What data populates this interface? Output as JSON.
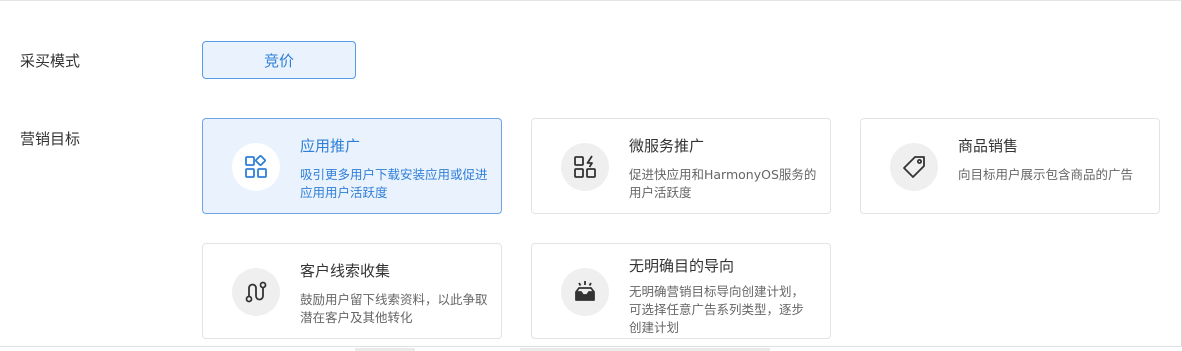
{
  "form": {
    "purchase_mode": {
      "label": "采买模式",
      "options": [
        "竞价"
      ],
      "selected": "竞价"
    },
    "marketing_goal": {
      "label": "营销目标",
      "cards": [
        {
          "title": "应用推广",
          "description": "吸引更多用户下载安装应用或促进应用用户活跃度",
          "icon": "app-grid-icon",
          "selected": true
        },
        {
          "title": "微服务推广",
          "description": "促进快应用和HarmonyOS服务的用户活跃度",
          "icon": "service-grid-icon",
          "selected": false
        },
        {
          "title": "商品销售",
          "description": "向目标用户展示包含商品的广告",
          "icon": "price-tag-icon",
          "selected": false
        },
        {
          "title": "客户线索收集",
          "description": "鼓励用户留下线索资料，以此争取潜在客户及其他转化",
          "icon": "lead-path-icon",
          "selected": false
        },
        {
          "title": "无明确目的导向",
          "description": "无明确营销目标导向创建计划，可选择任意广告系列类型，逐步创建计划",
          "icon": "inbox-tray-icon",
          "selected": false
        }
      ]
    }
  },
  "colors": {
    "accent": "#2f7fd8",
    "selected_bg": "#eaf2fd",
    "border": "#e3e3e3",
    "icon_bg": "#efefef",
    "text": "#333333",
    "muted": "#666666"
  }
}
